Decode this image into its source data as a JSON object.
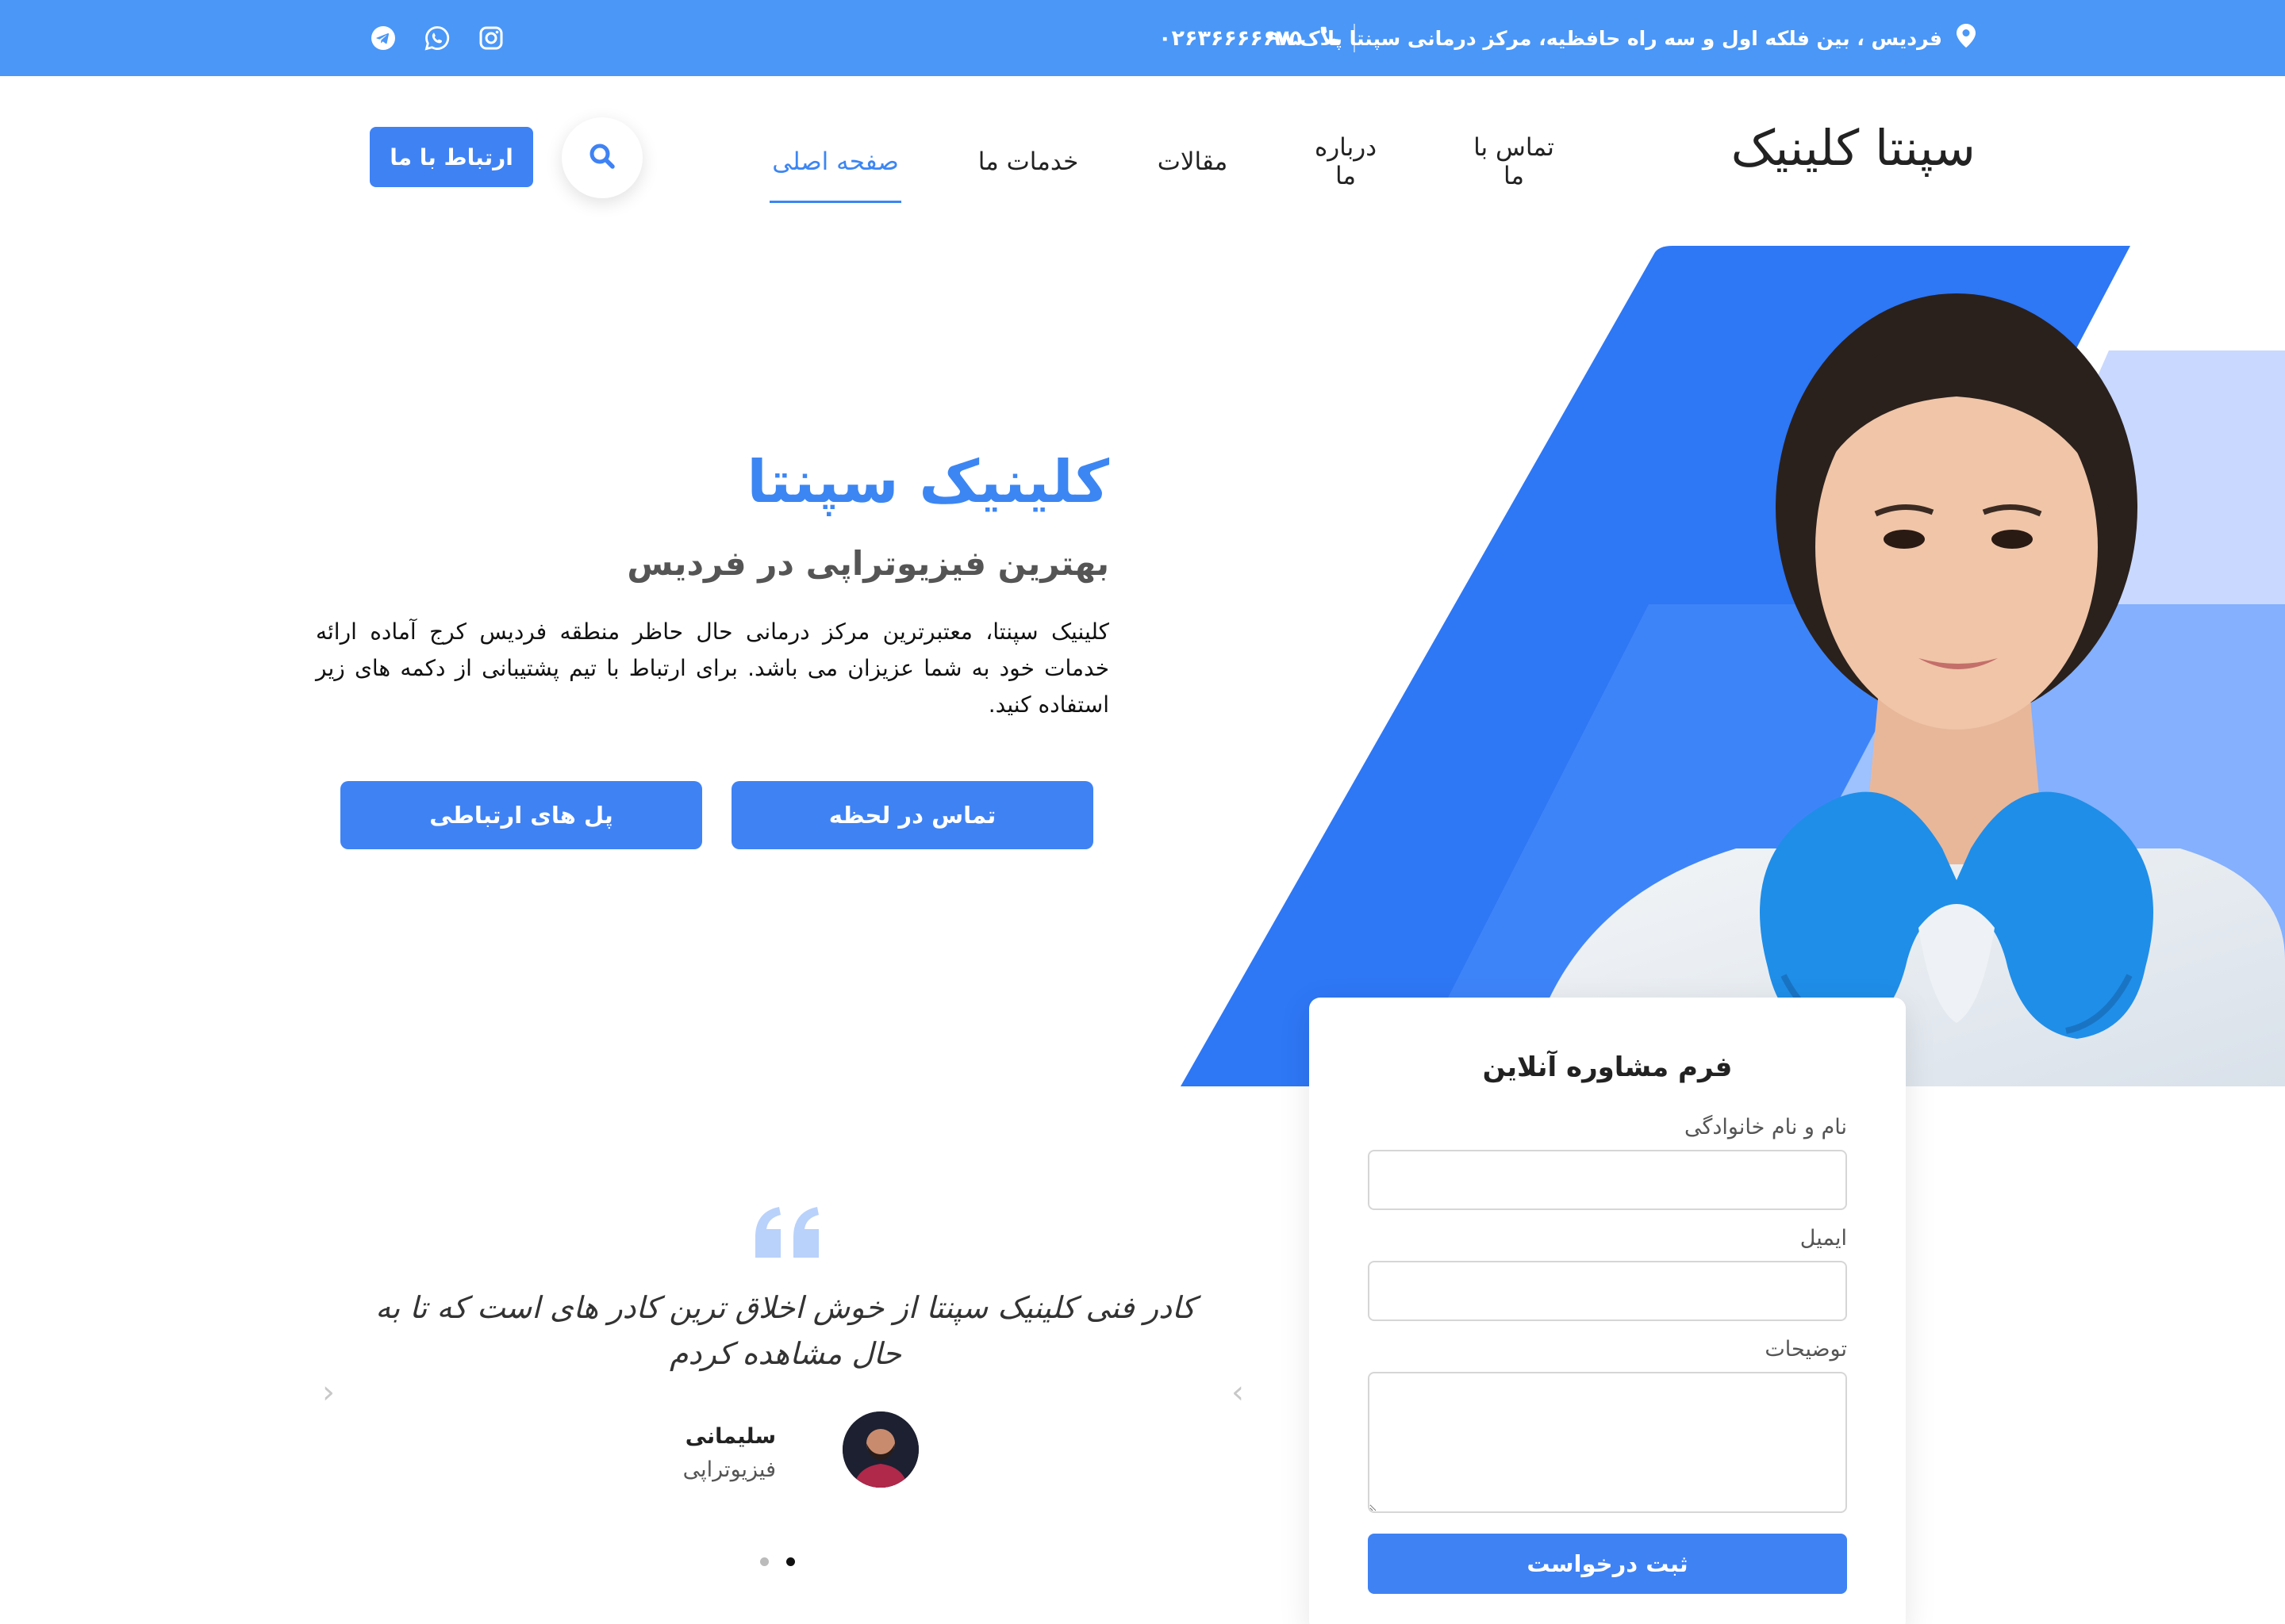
{
  "topbar": {
    "address": "فردیس ، بین فلکه اول و سه راه حافظیه، مرکز درمانی سپنتا پلاک ۹۸",
    "phone": "۰۲۶۳۶۶۶۶۶۷۵",
    "icons": [
      "location-pin-icon",
      "phone-icon",
      "telegram-icon",
      "whatsapp-icon",
      "instagram-icon"
    ]
  },
  "header": {
    "logo": "سپنتا کلینیک",
    "nav": [
      {
        "label": "صفحه اصلی",
        "active": true
      },
      {
        "label": "خدمات ما",
        "active": false
      },
      {
        "label": "مقالات",
        "active": false
      },
      {
        "label": "درباره ما",
        "active": false
      },
      {
        "label": "تماس با ما",
        "active": false
      }
    ],
    "contact_button": "ارتباط با ما"
  },
  "hero": {
    "title": "کلینیک سپنتا",
    "subtitle": "بهترین فیزیوتراپی در فردیس",
    "description": "کلینیک سپنتا، معتبرترین مرکز درمانی حال حاظر منطقه فردیس کرج آماده ارائه خدمات خود به شما عزیزان می باشد. برای ارتباط با تیم پشتیبانی از دکمه های زیر استفاده کنید.",
    "primary_button": "تماس در لحظه",
    "secondary_button": "پل های ارتباطی"
  },
  "form": {
    "title": "فرم مشاوره آنلاین",
    "name_label": "نام و نام خانوادگی",
    "email_label": "ایمیل",
    "notes_label": "توضیحات",
    "submit": "ثبت درخواست"
  },
  "testimonial": {
    "text": "کادر فنی کلینیک سپنتا از خوش اخلاق ترین کادر های است که تا به حال مشاهده کردم",
    "name": "سلیمانی",
    "role": "فیزیوتراپی",
    "slides": 2,
    "active_slide": 2
  },
  "colors": {
    "brand": "#3f82f4",
    "topbar": "#4a97f7",
    "light_shape": "#c8d8ff"
  }
}
